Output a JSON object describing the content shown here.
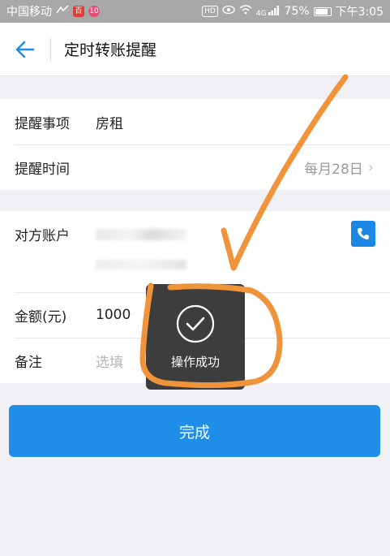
{
  "status_bar": {
    "carrier": "中国移动",
    "battery": "75%",
    "time": "下午3:05",
    "signal_label": "4G",
    "hd_label": "HD"
  },
  "nav": {
    "title": "定时转账提醒"
  },
  "form": {
    "reminder_item": {
      "label": "提醒事项",
      "value": "房租"
    },
    "reminder_time": {
      "label": "提醒时间",
      "value": "每月28日"
    },
    "account": {
      "label": "对方账户"
    },
    "amount": {
      "label": "金额(元)",
      "value": "1000"
    },
    "note": {
      "label": "备注",
      "placeholder": "选填"
    }
  },
  "done_button": {
    "label": "完成"
  },
  "toast": {
    "text": "操作成功"
  },
  "colors": {
    "accent": "#1f8ee9",
    "annotation": "#f0943c",
    "toast_bg": "#2d2d2d"
  }
}
